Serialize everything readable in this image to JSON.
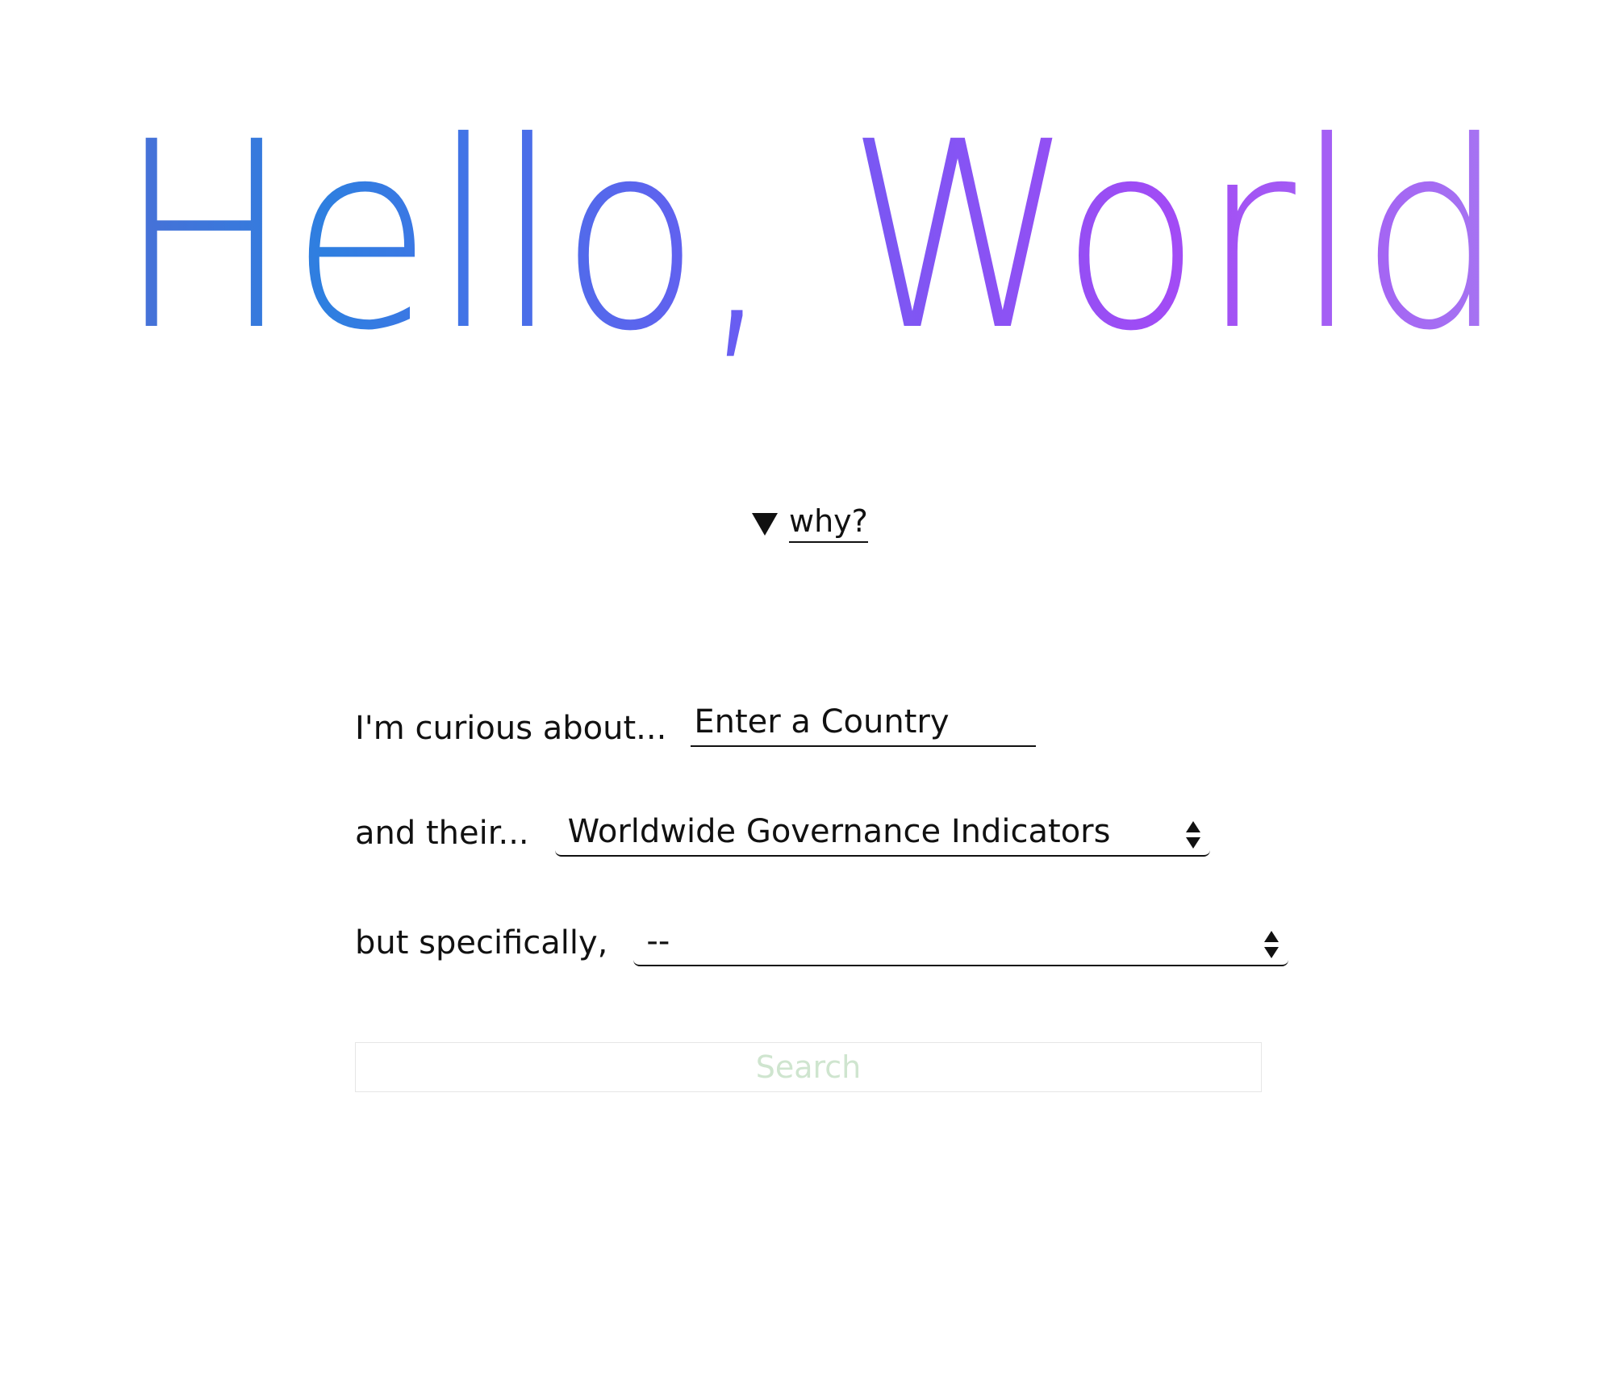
{
  "hero": {
    "title": "Hello, World",
    "gradient": [
      "#4a6fd6",
      "#2e7fe0",
      "#6a5cf2",
      "#a24bf5",
      "#a678f2"
    ]
  },
  "why": {
    "arrow_icon": "triangle-down-icon",
    "label": "why?"
  },
  "form": {
    "country": {
      "label": "I'm curious about...",
      "placeholder": "Enter a Country"
    },
    "category": {
      "label": "and their...",
      "selected": "Worldwide Governance Indicators",
      "icon": "select-arrows-icon"
    },
    "indicator": {
      "label": "but specifically,",
      "selected": "--",
      "icon": "select-arrows-icon"
    },
    "search_label": "Search",
    "search_color": "#cfe5cf"
  }
}
